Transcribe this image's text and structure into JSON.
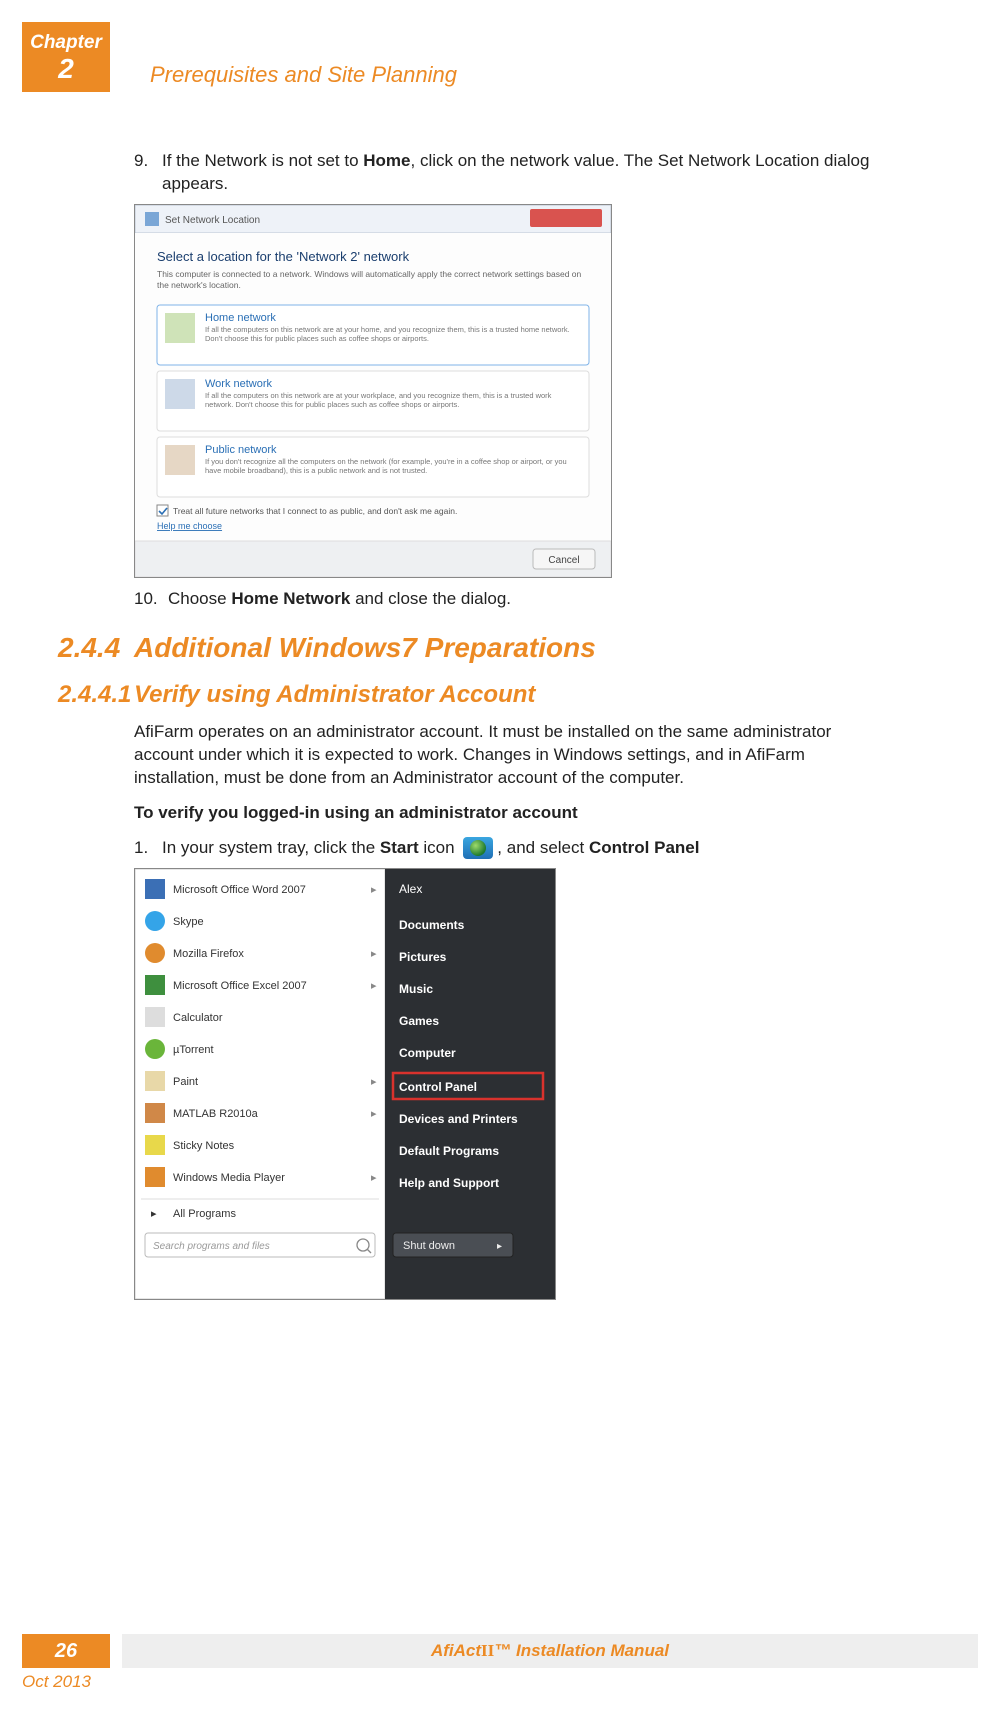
{
  "chapter": {
    "label": "Chapter",
    "number": "2"
  },
  "section_title": "Prerequisites and Site Planning",
  "steps": {
    "s9": {
      "num": "9.",
      "text_pre": "If the Network is not set to ",
      "bold1": "Home",
      "text_post": ", click on the network value. The Set Network Location dialog appears."
    },
    "s10": {
      "num": "10.",
      "text_pre": "Choose ",
      "bold1": "Home Network",
      "text_post": " and close the dialog."
    },
    "s1b": {
      "num": "1.",
      "pre": "In your system tray, click the ",
      "b1": "Start",
      "mid": " icon ",
      "post": ", and select ",
      "b2": "Control Panel"
    }
  },
  "headings": {
    "h244_num": "2.4.4",
    "h244_text": "Additional Windows7 Preparations",
    "h2441_num": "2.4.4.1",
    "h2441_text": "Verify using Administrator Account"
  },
  "para1": "AfiFarm operates on an administrator account. It must be installed on the same administrator account under which it is expected to work. Changes in Windows settings, and in AfiFarm installation, must be done from an Administrator account of the computer.",
  "bold_line": "To verify you logged-in using an administrator account",
  "fig1": {
    "title": "Set Network Location",
    "heading": "Select a location for the 'Network 2' network",
    "sub": "This computer is connected to a network. Windows will automatically apply the correct network settings based on the network's location.",
    "opt1": {
      "title": "Home network",
      "desc": "If all the computers on this network are at your home, and you recognize them, this is a trusted home network. Don't choose this for public places such as coffee shops or airports."
    },
    "opt2": {
      "title": "Work network",
      "desc": "If all the computers on this network are at your workplace, and you recognize them, this is a trusted work network. Don't choose this for public places such as coffee shops or airports."
    },
    "opt3": {
      "title": "Public network",
      "desc": "If you don't recognize all the computers on the network (for example, you're in a coffee shop or airport, or you have mobile broadband), this is a public network and is not trusted."
    },
    "checkbox": "Treat all future networks that I connect to as public, and don't ask me again.",
    "help": "Help me choose",
    "cancel": "Cancel"
  },
  "fig2": {
    "left": [
      "Microsoft Office Word 2007",
      "Skype",
      "Mozilla Firefox",
      "Microsoft Office Excel 2007",
      "Calculator",
      "µTorrent",
      "Paint",
      "MATLAB R2010a",
      "Sticky Notes",
      "Windows Media Player"
    ],
    "all": "All Programs",
    "search": "Search programs and files",
    "right_user": "Alex",
    "right": [
      "Documents",
      "Pictures",
      "Music",
      "Games",
      "Computer",
      "Control Panel",
      "Devices and Printers",
      "Default Programs",
      "Help and Support"
    ],
    "shutdown": "Shut down"
  },
  "footer": {
    "page": "26",
    "title_pre": "AfiAct ",
    "title_ii": "II",
    "title_post": "™ Installation Manual",
    "date": "Oct 2013"
  }
}
